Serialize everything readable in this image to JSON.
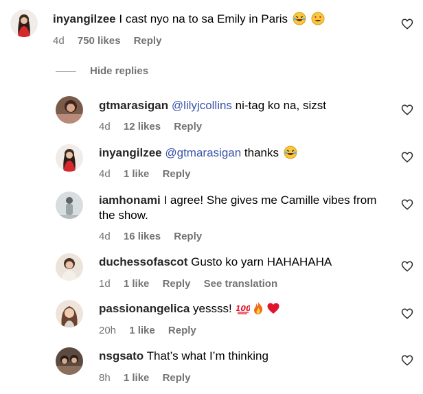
{
  "main_comment": {
    "username": "inyangilzee",
    "text": "I cast nyo na to sa Emily in Paris",
    "emojis": [
      "laughing-tears-emoji",
      "heart-eyes-emoji"
    ],
    "time": "4d",
    "likes": "750 likes",
    "reply": "Reply"
  },
  "hide_replies": "Hide replies",
  "replies": [
    {
      "username": "gtmarasigan",
      "mention": "@lilyjcollins",
      "text": " ni-tag ko na, sizst",
      "time": "4d",
      "likes": "12 likes",
      "reply": "Reply"
    },
    {
      "username": "inyangilzee",
      "mention": "@gtmarasigan",
      "text": " thanks",
      "time": "4d",
      "likes": "1 like",
      "reply": "Reply"
    },
    {
      "username": "iamhonami",
      "text": "I agree! She gives me Camille vibes from the show.",
      "time": "4d",
      "likes": "16 likes",
      "reply": "Reply"
    },
    {
      "username": "duchessofascot",
      "text": "Gusto ko yarn HAHAHAHA",
      "time": "1d",
      "likes": "1 like",
      "reply": "Reply",
      "translation": "See translation"
    },
    {
      "username": "passionangelica",
      "text": "yessss!",
      "time": "20h",
      "likes": "1 like",
      "reply": "Reply"
    },
    {
      "username": "nsgsato",
      "text": "That’s what I’m thinking",
      "time": "8h",
      "likes": "1 like",
      "reply": "Reply"
    }
  ],
  "icons": {
    "like": "heart-outline-icon",
    "emoji_100": "hundred-points-emoji",
    "emoji_fire": "fire-emoji",
    "emoji_heart": "red-heart-emoji"
  }
}
